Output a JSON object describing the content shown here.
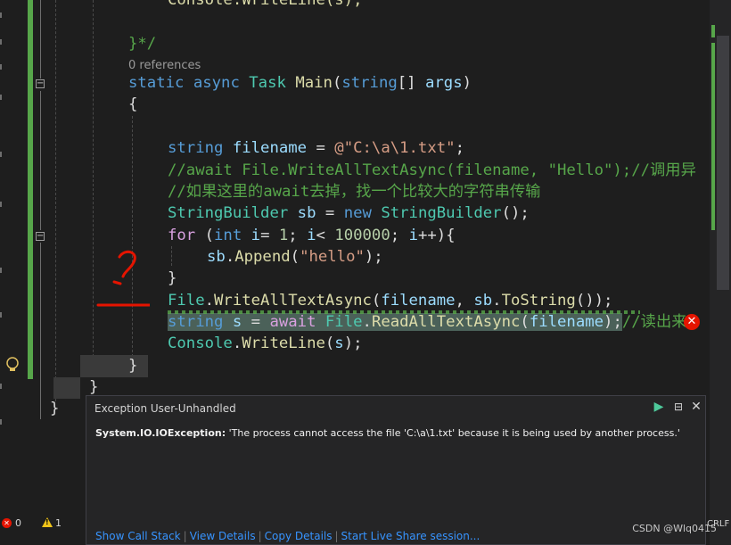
{
  "editor": {
    "code_lines": [
      {
        "id": "l0",
        "tokens": [
          [
            "fn",
            "Console.WriteLine(s);"
          ]
        ]
      },
      {
        "id": "l1",
        "tokens": [
          [
            "cm",
            "}*/"
          ]
        ]
      },
      {
        "id": "l2",
        "tokens": [
          [
            "kw",
            "static "
          ],
          [
            "kw",
            "async "
          ],
          [
            "ty",
            "Task "
          ],
          [
            "fn",
            "Main"
          ],
          [
            "pu",
            "("
          ],
          [
            "kw",
            "string"
          ],
          [
            "pu",
            "[] "
          ],
          [
            "id",
            "args"
          ],
          [
            "pu",
            ")"
          ]
        ]
      },
      {
        "id": "l3",
        "tokens": [
          [
            "pu",
            "{"
          ]
        ]
      },
      {
        "id": "l4",
        "tokens": [
          [
            "kw",
            "string "
          ],
          [
            "id",
            "filename"
          ],
          [
            "pu",
            " = "
          ],
          [
            "st",
            "@\"C:\\a\\1.txt\""
          ],
          [
            "pu",
            ";"
          ]
        ]
      },
      {
        "id": "l5",
        "tokens": [
          [
            "cm",
            "//await File.WriteAllTextAsync(filename, \"Hello\");//调用异"
          ]
        ]
      },
      {
        "id": "l6",
        "tokens": [
          [
            "cm",
            "//如果这里的await去掉，找一个比较大的字符串传输"
          ]
        ]
      },
      {
        "id": "l7",
        "tokens": [
          [
            "ty",
            "StringBuilder "
          ],
          [
            "id",
            "sb"
          ],
          [
            "pu",
            " = "
          ],
          [
            "kw",
            "new "
          ],
          [
            "ty",
            "StringBuilder"
          ],
          [
            "pu",
            "();"
          ]
        ]
      },
      {
        "id": "l8",
        "tokens": [
          [
            "ctl",
            "for "
          ],
          [
            "pu",
            "("
          ],
          [
            "kw",
            "int "
          ],
          [
            "id",
            "i"
          ],
          [
            "pu",
            "= "
          ],
          [
            "num",
            "1"
          ],
          [
            "pu",
            "; "
          ],
          [
            "id",
            "i"
          ],
          [
            "pu",
            "< "
          ],
          [
            "num",
            "100000"
          ],
          [
            "pu",
            "; "
          ],
          [
            "id",
            "i"
          ],
          [
            "pu",
            "++){"
          ]
        ]
      },
      {
        "id": "l9",
        "tokens": [
          [
            "id",
            "sb"
          ],
          [
            "pu",
            "."
          ],
          [
            "fn",
            "Append"
          ],
          [
            "pu",
            "("
          ],
          [
            "st",
            "\"hello\""
          ],
          [
            "pu",
            ");"
          ]
        ]
      },
      {
        "id": "l10",
        "tokens": [
          [
            "pu",
            "}"
          ]
        ]
      },
      {
        "id": "l11",
        "tokens": [
          [
            "ty",
            "File"
          ],
          [
            "pu",
            "."
          ],
          [
            "fn",
            "WriteAllTextAsync"
          ],
          [
            "pu",
            "("
          ],
          [
            "id",
            "filename"
          ],
          [
            "pu",
            ", "
          ],
          [
            "id",
            "sb"
          ],
          [
            "pu",
            "."
          ],
          [
            "fn",
            "ToString"
          ],
          [
            "pu",
            "());"
          ]
        ]
      },
      {
        "id": "l12",
        "tokens": [
          [
            "kw",
            "string "
          ],
          [
            "id",
            "s"
          ],
          [
            "pu",
            " = "
          ],
          [
            "ctl",
            "await "
          ],
          [
            "ty",
            "File"
          ],
          [
            "pu",
            "."
          ],
          [
            "fn",
            "ReadAllTextAsync"
          ],
          [
            "pu",
            "("
          ],
          [
            "id",
            "filename"
          ],
          [
            "pu",
            ");"
          ],
          [
            "cm",
            "//读出来"
          ]
        ]
      },
      {
        "id": "l13",
        "tokens": [
          [
            "ty",
            "Console"
          ],
          [
            "pu",
            "."
          ],
          [
            "fn",
            "WriteLine"
          ],
          [
            "pu",
            "("
          ],
          [
            "id",
            "s"
          ],
          [
            "pu",
            ");"
          ]
        ]
      },
      {
        "id": "l14",
        "tokens": [
          [
            "pu",
            "}"
          ]
        ]
      },
      {
        "id": "l15",
        "tokens": [
          [
            "pu",
            "}"
          ]
        ]
      },
      {
        "id": "l16",
        "tokens": [
          [
            "pu",
            "}"
          ]
        ]
      }
    ],
    "references_label": "0 references",
    "annotation_mark": "?",
    "colors": {
      "keyword": "#569cd6",
      "type": "#4ec9b0",
      "method": "#dcdcaa",
      "string": "#d69d85",
      "comment": "#57a64a",
      "number": "#b5cea8",
      "control": "#d8a0df",
      "identifier": "#9cdcfe"
    }
  },
  "exception_popup": {
    "title": "Exception User-Unhandled",
    "exception_type": "System.IO.IOException:",
    "message": "'The process cannot access the file 'C:\\a\\1.txt' because it is being used by another process.'",
    "links": [
      "Show Call Stack",
      "View Details",
      "Copy Details",
      "Start Live Share session..."
    ],
    "icons": [
      "play-icon",
      "pin-icon",
      "close-icon"
    ]
  },
  "status_bar": {
    "errors": "0",
    "warnings": "1",
    "line_ending": "CRLF"
  },
  "watermark": "CSDN @Wlq0415"
}
